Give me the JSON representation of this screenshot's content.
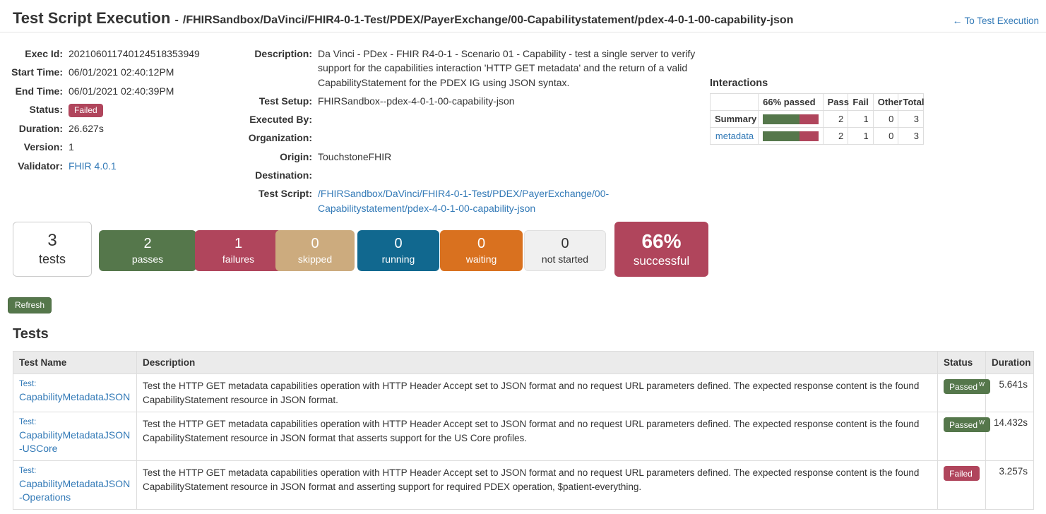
{
  "header": {
    "title": "Test Script Execution",
    "separator": "-",
    "path": "/FHIRSandbox/DaVinci/FHIR4-0-1-Test/PDEX/PayerExchange/00-Capabilitystatement/pdex-4-0-1-00-capability-json",
    "back_link": "To Test Execution",
    "back_arrow": "←"
  },
  "details_left": {
    "exec_id_label": "Exec Id:",
    "exec_id": "202106011740124518353949",
    "start_time_label": "Start Time:",
    "start_time": "06/01/2021 02:40:12PM",
    "end_time_label": "End Time:",
    "end_time": "06/01/2021 02:40:39PM",
    "status_label": "Status:",
    "status": "Failed",
    "duration_label": "Duration:",
    "duration": "26.627s",
    "version_label": "Version:",
    "version": "1",
    "validator_label": "Validator:",
    "validator": "FHIR 4.0.1"
  },
  "details_mid": {
    "description_label": "Description:",
    "description": "Da Vinci - PDex - FHIR R4-0-1 - Scenario 01 - Capability - test a single server to verify support for the capabilities interaction 'HTTP GET metadata' and the return of a valid CapabilityStatement for the PDEX IG using JSON syntax.",
    "test_setup_label": "Test Setup:",
    "test_setup": "FHIRSandbox--pdex-4-0-1-00-capability-json",
    "executed_by_label": "Executed By:",
    "executed_by": "",
    "organization_label": "Organization:",
    "organization": "",
    "origin_label": "Origin:",
    "origin": "TouchstoneFHIR",
    "destination_label": "Destination:",
    "destination": "",
    "test_script_label": "Test Script:",
    "test_script": "/FHIRSandbox/DaVinci/FHIR4-0-1-Test/PDEX/PayerExchange/00-Capabilitystatement/pdex-4-0-1-00-capability-json"
  },
  "interactions": {
    "title": "Interactions",
    "headers": [
      "",
      "66% passed",
      "Pass",
      "Fail",
      "Other",
      "Total"
    ],
    "rows": [
      {
        "name": "Summary",
        "is_link": false,
        "pass_pct": 66,
        "pass": "2",
        "fail": "1",
        "other": "0",
        "total": "3"
      },
      {
        "name": "metadata",
        "is_link": true,
        "pass_pct": 66,
        "pass": "2",
        "fail": "1",
        "other": "0",
        "total": "3"
      }
    ]
  },
  "stats": [
    {
      "num": "3",
      "label": "tests",
      "color": "#ffffff"
    },
    {
      "num": "2",
      "label": "passes",
      "color": "#55774b"
    },
    {
      "num": "1",
      "label": "failures",
      "color": "#b0455c"
    },
    {
      "num": "0",
      "label": "skipped",
      "color": "#ccab7e"
    },
    {
      "num": "0",
      "label": "running",
      "color": "#11688f"
    },
    {
      "num": "0",
      "label": "waiting",
      "color": "#d9711f"
    },
    {
      "num": "0",
      "label": "not started",
      "color": "#f0f0f0"
    },
    {
      "num": "66%",
      "label": "successful",
      "color": "#b0455c"
    }
  ],
  "refresh_label": "Refresh",
  "tests_section": {
    "heading": "Tests",
    "columns": [
      "Test Name",
      "Description",
      "Status",
      "Duration"
    ],
    "rows": [
      {
        "test_label": "Test:",
        "test_name": "CapabilityMetadataJSON",
        "description": "Test the HTTP GET metadata capabilities operation with HTTP Header Accept set to JSON format and no request URL parameters defined. The expected response content is the found CapabilityStatement resource in JSON format.",
        "status": "Passed",
        "status_sup": "W",
        "duration": "5.641s"
      },
      {
        "test_label": "Test:",
        "test_name": "CapabilityMetadataJSON-USCore",
        "description": "Test the HTTP GET metadata capabilities operation with HTTP Header Accept set to JSON format and no request URL parameters defined. The expected response content is the found CapabilityStatement resource in JSON format that asserts support for the US Core profiles.",
        "status": "Passed",
        "status_sup": "W",
        "duration": "14.432s"
      },
      {
        "test_label": "Test:",
        "test_name": "CapabilityMetadataJSON-Operations",
        "description": "Test the HTTP GET metadata capabilities operation with HTTP Header Accept set to JSON format and no request URL parameters defined. The expected response content is the found CapabilityStatement resource in JSON format and asserting support for required PDEX operation, $patient-everything.",
        "status": "Failed",
        "status_sup": "",
        "duration": "3.257s"
      }
    ]
  },
  "colors": {
    "pass_green": "#55774b",
    "fail_crimson": "#b0455c",
    "skipped_tan": "#ccab7e",
    "running_blue": "#11688f",
    "waiting_orange": "#d9711f",
    "link_blue": "#337ab7"
  }
}
